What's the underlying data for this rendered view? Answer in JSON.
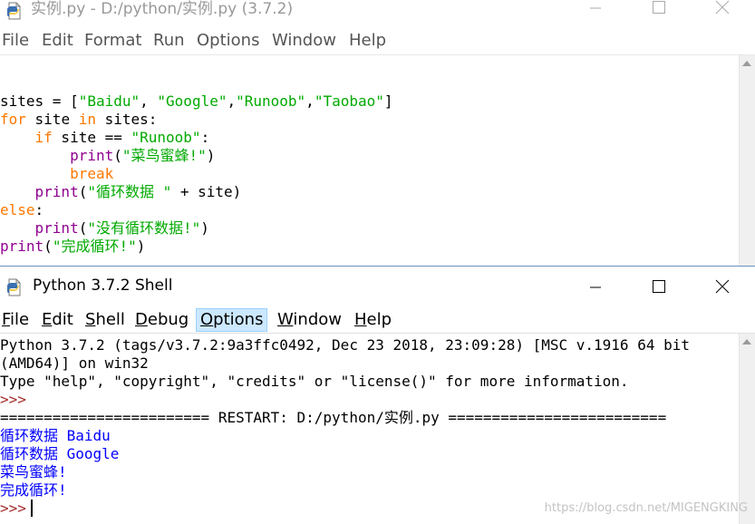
{
  "editor": {
    "title": "实例.py - D:/python/实例.py (3.7.2)",
    "menu": [
      "File",
      "Edit",
      "Format",
      "Run",
      "Options",
      "Window",
      "Help"
    ],
    "code_lines": [
      [
        {
          "t": "sites = [",
          "c": ""
        },
        {
          "t": "\"Baidu\"",
          "c": "str"
        },
        {
          "t": ", ",
          "c": ""
        },
        {
          "t": "\"Google\"",
          "c": "str"
        },
        {
          "t": ",",
          "c": ""
        },
        {
          "t": "\"Runoob\"",
          "c": "str"
        },
        {
          "t": ",",
          "c": ""
        },
        {
          "t": "\"Taobao\"",
          "c": "str"
        },
        {
          "t": "]",
          "c": ""
        }
      ],
      [
        {
          "t": "for",
          "c": "kw"
        },
        {
          "t": " site ",
          "c": ""
        },
        {
          "t": "in",
          "c": "kw"
        },
        {
          "t": " sites:",
          "c": ""
        }
      ],
      [
        {
          "t": "    ",
          "c": ""
        },
        {
          "t": "if",
          "c": "kw"
        },
        {
          "t": " site == ",
          "c": ""
        },
        {
          "t": "\"Runoob\"",
          "c": "str"
        },
        {
          "t": ":",
          "c": ""
        }
      ],
      [
        {
          "t": "        ",
          "c": ""
        },
        {
          "t": "print",
          "c": "bi"
        },
        {
          "t": "(",
          "c": ""
        },
        {
          "t": "\"菜鸟蜜蜂!\"",
          "c": "str"
        },
        {
          "t": ")",
          "c": ""
        }
      ],
      [
        {
          "t": "        ",
          "c": ""
        },
        {
          "t": "break",
          "c": "kw"
        }
      ],
      [
        {
          "t": "    ",
          "c": ""
        },
        {
          "t": "print",
          "c": "bi"
        },
        {
          "t": "(",
          "c": ""
        },
        {
          "t": "\"循环数据 \"",
          "c": "str"
        },
        {
          "t": " + site)",
          "c": ""
        }
      ],
      [
        {
          "t": "else",
          "c": "kw"
        },
        {
          "t": ":",
          "c": ""
        }
      ],
      [
        {
          "t": "    ",
          "c": ""
        },
        {
          "t": "print",
          "c": "bi"
        },
        {
          "t": "(",
          "c": ""
        },
        {
          "t": "\"没有循环数据!\"",
          "c": "str"
        },
        {
          "t": ")",
          "c": ""
        }
      ],
      [
        {
          "t": "print",
          "c": "bi"
        },
        {
          "t": "(",
          "c": ""
        },
        {
          "t": "\"完成循环!\"",
          "c": "str"
        },
        {
          "t": ")",
          "c": ""
        }
      ]
    ]
  },
  "shell": {
    "title": "Python 3.7.2 Shell",
    "menu": [
      "File",
      "Edit",
      "Shell",
      "Debug",
      "Options",
      "Window",
      "Help"
    ],
    "active_menu_index": 4,
    "lines": [
      [
        {
          "t": "Python 3.7.2 (tags/v3.7.2:9a3ffc0492, Dec 23 2018, 23:09:28) [MSC v.1916 64 bit",
          "c": ""
        }
      ],
      [
        {
          "t": "(AMD64)] on win32",
          "c": ""
        }
      ],
      [
        {
          "t": "Type \"help\", \"copyright\", \"credits\" or \"license()\" for more information.",
          "c": ""
        }
      ],
      [
        {
          "t": ">>>",
          "c": "prompt"
        }
      ],
      [
        {
          "t": "======================== RESTART: D:/python/实例.py =========================",
          "c": ""
        }
      ],
      [
        {
          "t": "循环数据 Baidu",
          "c": "out"
        }
      ],
      [
        {
          "t": "循环数据 Google",
          "c": "out"
        }
      ],
      [
        {
          "t": "菜鸟蜜蜂!",
          "c": "out"
        }
      ],
      [
        {
          "t": "完成循环!",
          "c": "out"
        }
      ],
      [
        {
          "t": ">>>",
          "c": "prompt"
        }
      ]
    ]
  },
  "watermark": "https://blog.csdn.net/MIGENGKING",
  "colors": {
    "keyword": "#ff7700",
    "builtin": "#900090",
    "string": "#00aa00",
    "output": "#0000ff",
    "prompt": "#a52a2a",
    "menu_highlight": "#cce8ff"
  }
}
